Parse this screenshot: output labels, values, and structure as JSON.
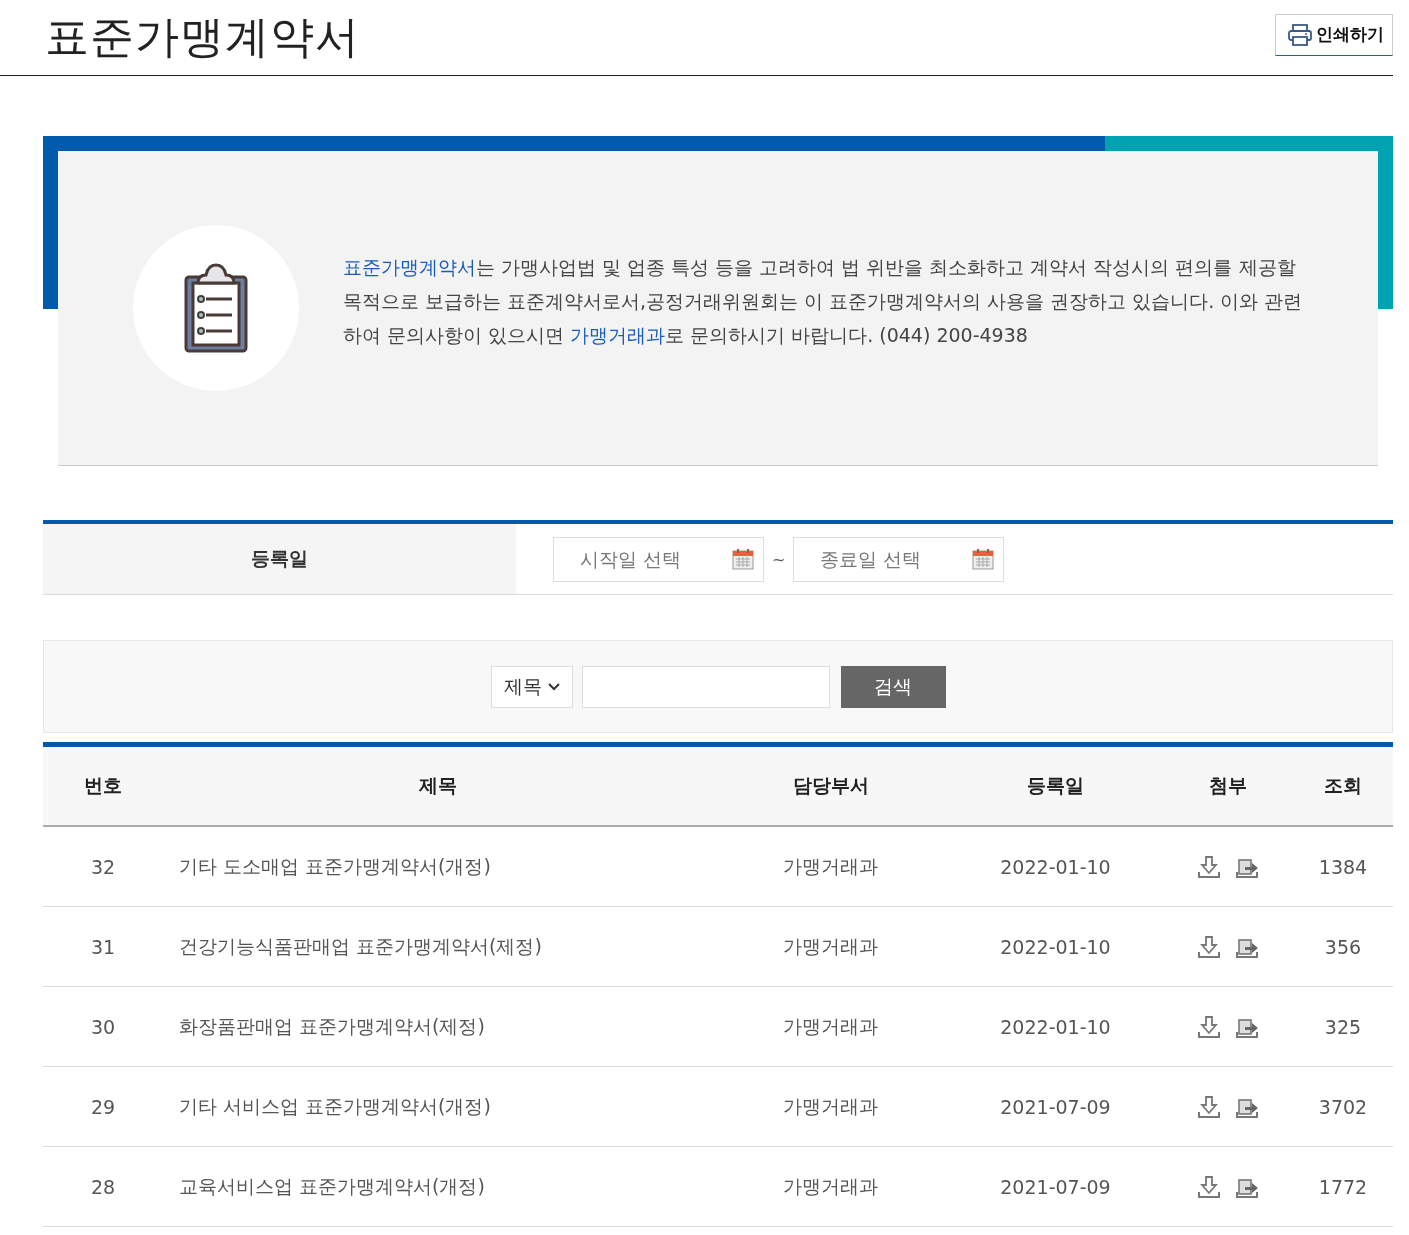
{
  "page_title": "표준가맹계약서",
  "print_button": "인쇄하기",
  "intro": [
    {
      "text": "표준가맹계약서",
      "link": true
    },
    {
      "text": "는 가맹사업법 및 업종 특성 등을 고려하여 법 위반을 최소화하고 계약서 작성시의 편의를 제공할 목적으로 보급하는 표준계약서로서,공정거래위원회는 이 표준가맹계약서의 사용을 권장하고 있습니다. 이와 관련하여 문의사항이 있으시면 ",
      "link": false
    },
    {
      "text": "가맹거래과",
      "link": true
    },
    {
      "text": "로 문의하시기 바랍니다. (044) 200-4938",
      "link": false
    }
  ],
  "date_filter": {
    "label": "등록일",
    "start_placeholder": "시작일 선택",
    "separator": "~",
    "end_placeholder": "종료일 선택"
  },
  "search": {
    "field_select": "제목",
    "button": "검색"
  },
  "table": {
    "columns": [
      "번호",
      "제목",
      "담당부서",
      "등록일",
      "첨부",
      "조회"
    ],
    "rows": [
      {
        "no": "32",
        "title": "기타 도소매업 표준가맹계약서(개정)",
        "dept": "가맹거래과",
        "date": "2022-01-10",
        "views": "1384"
      },
      {
        "no": "31",
        "title": "건강기능식품판매업 표준가맹계약서(제정)",
        "dept": "가맹거래과",
        "date": "2022-01-10",
        "views": "356"
      },
      {
        "no": "30",
        "title": "화장품판매업 표준가맹계약서(제정)",
        "dept": "가맹거래과",
        "date": "2022-01-10",
        "views": "325"
      },
      {
        "no": "29",
        "title": "기타 서비스업 표준가맹계약서(개정)",
        "dept": "가맹거래과",
        "date": "2021-07-09",
        "views": "3702"
      },
      {
        "no": "28",
        "title": "교육서비스업 표준가맹계약서(개정)",
        "dept": "가맹거래과",
        "date": "2021-07-09",
        "views": "1772"
      }
    ]
  }
}
